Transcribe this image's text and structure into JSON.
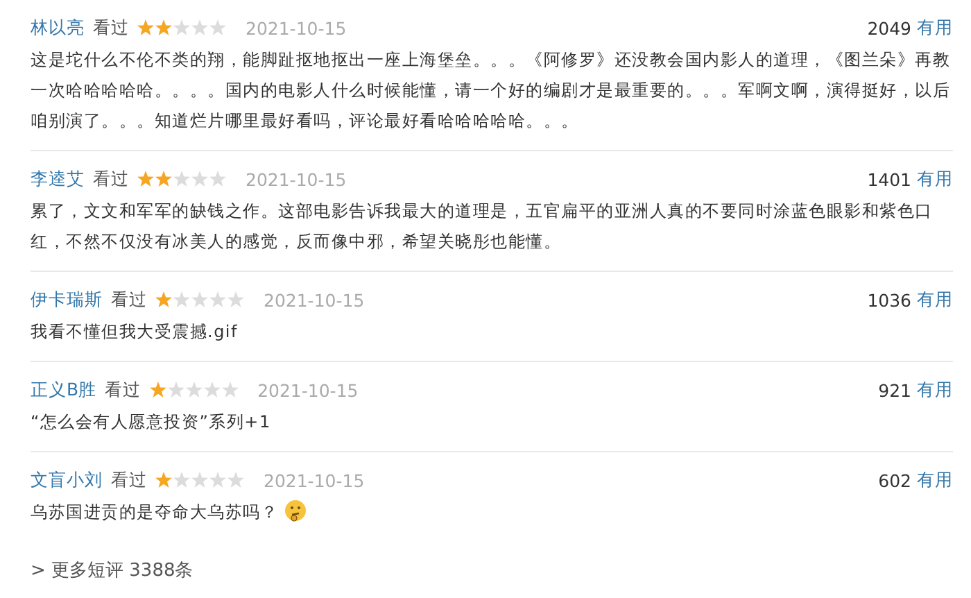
{
  "reviews": [
    {
      "user": "林以亮",
      "status": "看过",
      "stars": 2,
      "date": "2021-10-15",
      "votes": "2049",
      "vote_label": "有用",
      "text": "这是坨什么不伦不类的翔，能脚趾抠地抠出一座上海堡垒。。。《阿修罗》还没教会国内影人的道理，《图兰朵》再教一次哈哈哈哈哈。。。。国内的电影人什么时候能懂，请一个好的编剧才是最重要的。。。军啊文啊，演得挺好，以后咱别演了。。。知道烂片哪里最好看吗，评论最好看哈哈哈哈哈。。。",
      "emoji": false
    },
    {
      "user": "李逵艾",
      "status": "看过",
      "stars": 2,
      "date": "2021-10-15",
      "votes": "1401",
      "vote_label": "有用",
      "text": "累了，文文和军军的缺钱之作。这部电影告诉我最大的道理是，五官扁平的亚洲人真的不要同时涂蓝色眼影和紫色口红，不然不仅没有冰美人的感觉，反而像中邪，希望关晓彤也能懂。",
      "emoji": false
    },
    {
      "user": "伊卡瑞斯",
      "status": "看过",
      "stars": 1,
      "date": "2021-10-15",
      "votes": "1036",
      "vote_label": "有用",
      "text": "我看不懂但我大受震撼.gif",
      "emoji": false
    },
    {
      "user": "正义B胜",
      "status": "看过",
      "stars": 1,
      "date": "2021-10-15",
      "votes": "921",
      "vote_label": "有用",
      "text": "“怎么会有人愿意投资”系列+1",
      "emoji": false
    },
    {
      "user": "文盲小刘",
      "status": "看过",
      "stars": 1,
      "date": "2021-10-15",
      "votes": "602",
      "vote_label": "有用",
      "text": "乌苏国进贡的是夺命大乌苏吗？",
      "emoji": true
    }
  ],
  "more_link": "> 更多短评 3388条"
}
